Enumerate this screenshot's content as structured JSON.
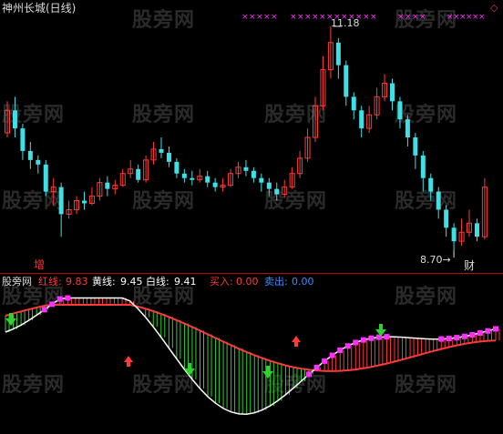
{
  "panel": {
    "title": "神州长城(日线)",
    "diamond": "◇",
    "high_label": "11.18",
    "low_label": "8.70",
    "arrow": "→",
    "signal_zeng": "增",
    "signal_cai": "财"
  },
  "indicator": {
    "name": "股旁网",
    "red_label": "红线:",
    "red_value": "9.83",
    "yellow_label": "黄线:",
    "yellow_value": "9.45",
    "white_label": "白线:",
    "white_value": "9.41",
    "buy_label": "买入:",
    "buy_value": "0.00",
    "sell_label": "卖出:",
    "sell_value": "0.00"
  },
  "watermark": "股旁网",
  "colors": {
    "up": "#ff3a3a",
    "down": "#3ee0e6",
    "white": "#ffffff",
    "magenta": "#ff30ff",
    "green": "#30d030",
    "background": "#000000"
  },
  "chart_data": {
    "type": "candlestick",
    "high_marked": 11.18,
    "low_marked": 8.7,
    "candles": [
      [
        10.0,
        10.25,
        10.35,
        9.95
      ],
      [
        10.25,
        10.05,
        10.4,
        9.95
      ],
      [
        10.05,
        9.8,
        10.1,
        9.7
      ],
      [
        9.8,
        9.7,
        9.9,
        9.6
      ],
      [
        9.7,
        9.65,
        9.75,
        9.55
      ],
      [
        9.65,
        9.35,
        9.7,
        9.3
      ],
      [
        9.35,
        9.4,
        9.5,
        9.2
      ],
      [
        9.4,
        9.1,
        9.45,
        8.85
      ],
      [
        9.1,
        9.15,
        9.25,
        9.05
      ],
      [
        9.15,
        9.25,
        9.3,
        9.1
      ],
      [
        9.25,
        9.22,
        9.35,
        9.15
      ],
      [
        9.22,
        9.3,
        9.4,
        9.2
      ],
      [
        9.3,
        9.45,
        9.5,
        9.25
      ],
      [
        9.45,
        9.38,
        9.52,
        9.3
      ],
      [
        9.38,
        9.42,
        9.48,
        9.32
      ],
      [
        9.42,
        9.55,
        9.6,
        9.4
      ],
      [
        9.55,
        9.6,
        9.7,
        9.5
      ],
      [
        9.6,
        9.48,
        9.65,
        9.45
      ],
      [
        9.48,
        9.7,
        9.75,
        9.45
      ],
      [
        9.7,
        9.82,
        9.9,
        9.65
      ],
      [
        9.82,
        9.78,
        9.95,
        9.72
      ],
      [
        9.78,
        9.68,
        9.85,
        9.62
      ],
      [
        9.68,
        9.55,
        9.72,
        9.5
      ],
      [
        9.55,
        9.5,
        9.6,
        9.45
      ],
      [
        9.5,
        9.48,
        9.58,
        9.42
      ],
      [
        9.48,
        9.52,
        9.6,
        9.45
      ],
      [
        9.52,
        9.45,
        9.58,
        9.4
      ],
      [
        9.45,
        9.4,
        9.5,
        9.35
      ],
      [
        9.4,
        9.42,
        9.5,
        9.35
      ],
      [
        9.42,
        9.55,
        9.6,
        9.4
      ],
      [
        9.55,
        9.62,
        9.68,
        9.5
      ],
      [
        9.62,
        9.58,
        9.7,
        9.52
      ],
      [
        9.58,
        9.5,
        9.62,
        9.45
      ],
      [
        9.5,
        9.45,
        9.55,
        9.35
      ],
      [
        9.45,
        9.38,
        9.5,
        9.3
      ],
      [
        9.38,
        9.32,
        9.45,
        9.25
      ],
      [
        9.32,
        9.4,
        9.48,
        9.28
      ],
      [
        9.4,
        9.55,
        9.62,
        9.38
      ],
      [
        9.55,
        9.72,
        9.8,
        9.5
      ],
      [
        9.72,
        9.95,
        10.05,
        9.68
      ],
      [
        9.95,
        10.3,
        10.4,
        9.9
      ],
      [
        10.3,
        10.7,
        10.85,
        10.25
      ],
      [
        10.7,
        11.0,
        11.18,
        10.6
      ],
      [
        11.0,
        10.75,
        11.05,
        10.6
      ],
      [
        10.75,
        10.4,
        10.8,
        10.3
      ],
      [
        10.4,
        10.25,
        10.45,
        10.15
      ],
      [
        10.25,
        10.05,
        10.3,
        9.95
      ],
      [
        10.05,
        10.2,
        10.3,
        10.0
      ],
      [
        10.2,
        10.4,
        10.5,
        10.15
      ],
      [
        10.4,
        10.55,
        10.65,
        10.35
      ],
      [
        10.55,
        10.35,
        10.6,
        10.25
      ],
      [
        10.35,
        10.15,
        10.4,
        10.05
      ],
      [
        10.15,
        9.95,
        10.2,
        9.85
      ],
      [
        9.95,
        9.75,
        10.0,
        9.6
      ],
      [
        9.75,
        9.5,
        9.8,
        9.35
      ],
      [
        9.5,
        9.35,
        9.55,
        9.25
      ],
      [
        9.35,
        9.15,
        9.4,
        9.05
      ],
      [
        9.15,
        8.95,
        9.2,
        8.85
      ],
      [
        8.95,
        8.8,
        9.0,
        8.7
      ],
      [
        8.8,
        8.9,
        9.05,
        8.75
      ],
      [
        8.9,
        9.0,
        9.15,
        8.85
      ],
      [
        9.0,
        8.85,
        9.05,
        8.8
      ],
      [
        8.85,
        9.4,
        9.5,
        8.82
      ]
    ],
    "indicator_values": {
      "red": 9.83,
      "yellow": 9.45,
      "white": 9.41,
      "buy": 0.0,
      "sell": 0.0
    }
  }
}
